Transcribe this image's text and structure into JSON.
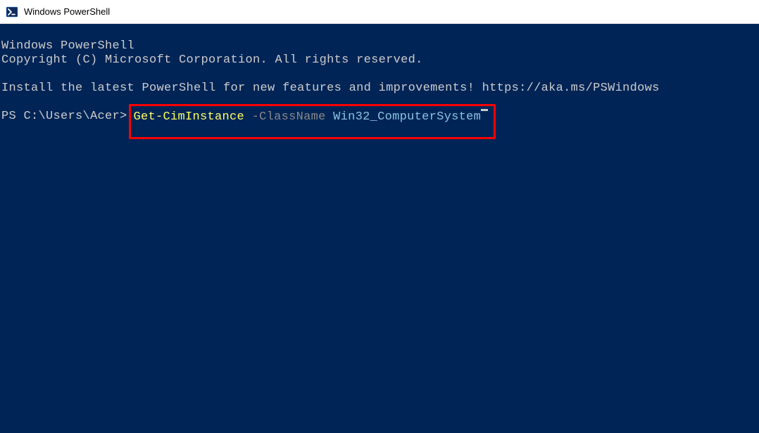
{
  "titlebar": {
    "title": "Windows PowerShell"
  },
  "terminal": {
    "line1": "Windows PowerShell",
    "line2": "Copyright (C) Microsoft Corporation. All rights reserved.",
    "line3": "Install the latest PowerShell for new features and improvements! https://aka.ms/PSWindows",
    "prompt": "PS C:\\Users\\Acer>",
    "command": {
      "cmdlet": "Get-CimInstance",
      "param_flag": " -ClassName ",
      "param_value": "Win32_ComputerSystem"
    }
  }
}
